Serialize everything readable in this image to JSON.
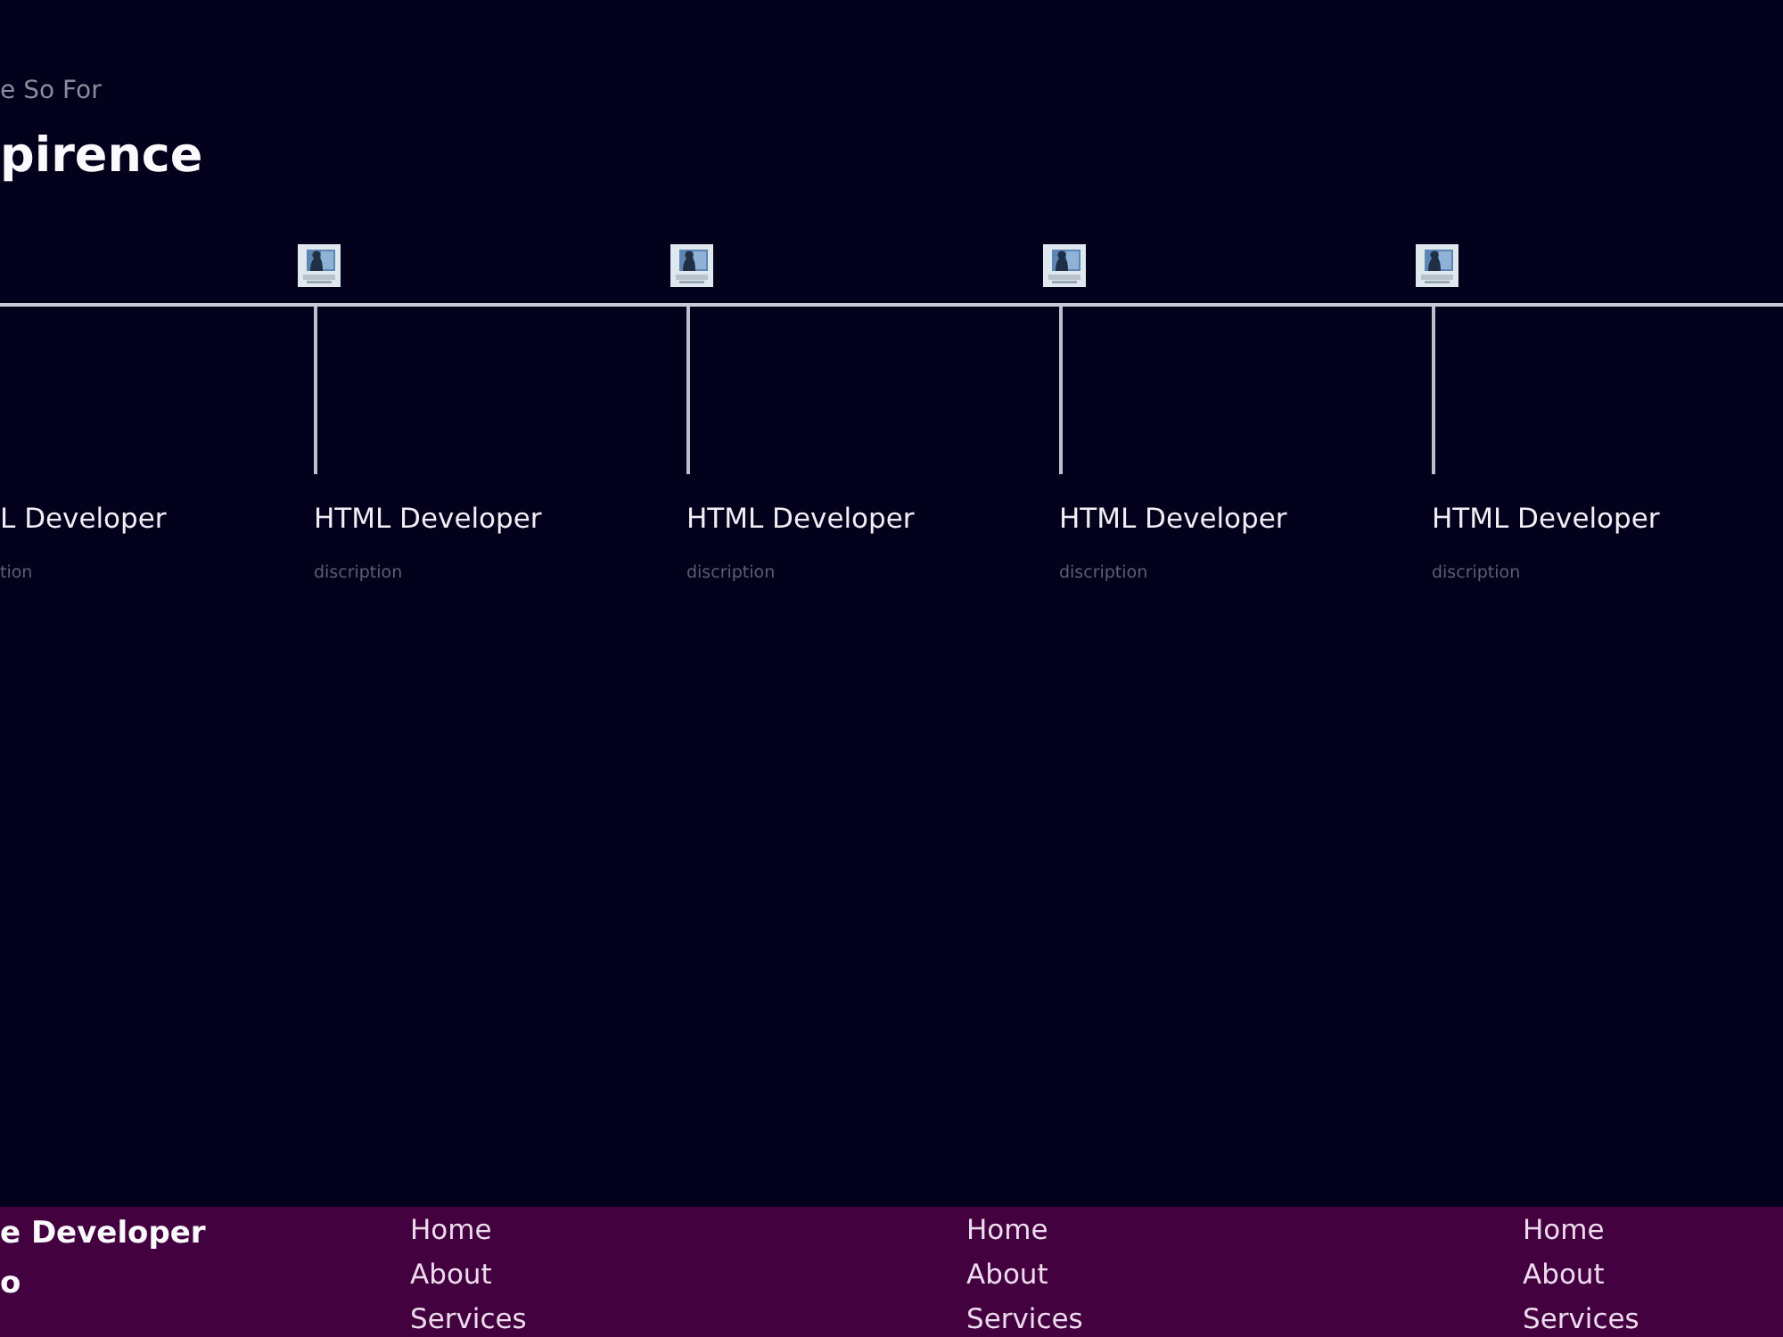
{
  "section": {
    "subtitle": "e So For",
    "title": "pirence"
  },
  "timeline": {
    "items": [
      {
        "kind": "edge",
        "title": "L Developer",
        "description": "tion"
      },
      {
        "kind": "milestone",
        "title": "HTML Developer",
        "description": "discription"
      },
      {
        "kind": "milestone",
        "title": "HTML Developer",
        "description": "discription"
      },
      {
        "kind": "milestone",
        "title": "HTML Developer",
        "description": "discription"
      },
      {
        "kind": "milestone",
        "title": "HTML Developer",
        "description": "discription"
      }
    ]
  },
  "footer": {
    "brand": {
      "title": "e Developer",
      "subtitle": "o"
    },
    "link_groups": [
      [
        "Home",
        "About",
        "Services"
      ],
      [
        "Home",
        "About",
        "Services"
      ],
      [
        "Home",
        "About",
        "Services"
      ]
    ]
  }
}
